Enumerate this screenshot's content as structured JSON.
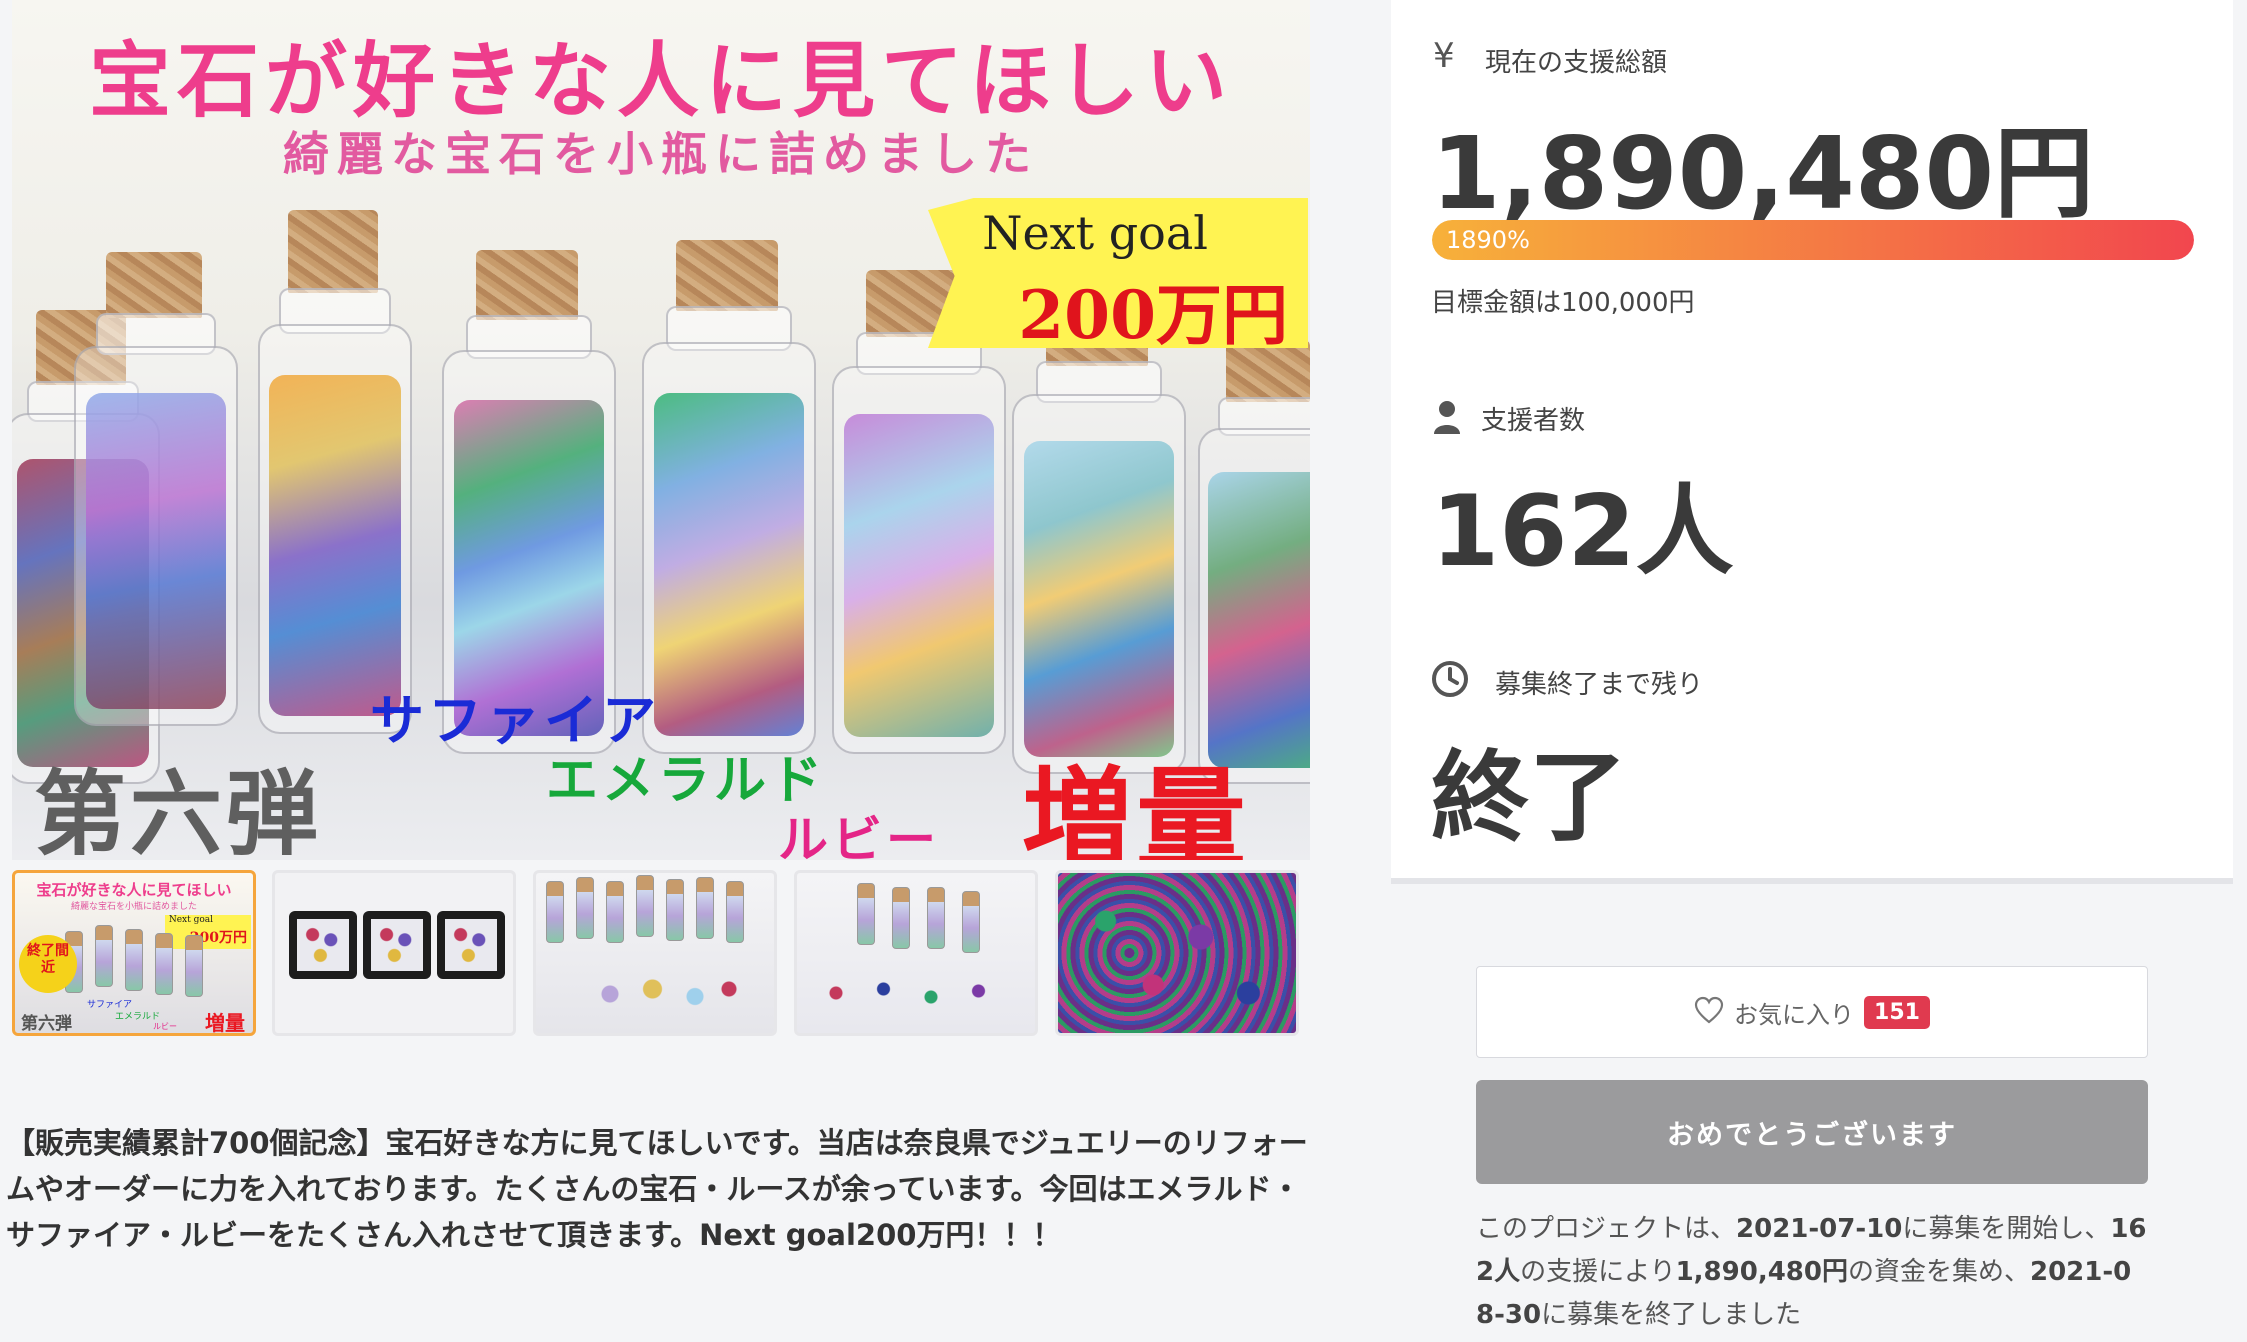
{
  "hero": {
    "title": "宝石が好きな人に見てほしい",
    "subtitle": "綺麗な宝石を小瓶に詰めました",
    "goal_line1": "Next goal",
    "goal_line2": "200万円",
    "series": "第六弾",
    "gem_sapphire": "サファイア",
    "gem_emerald": "エメラルド",
    "gem_ruby": "ルビー",
    "increase": "増量"
  },
  "thumbnails": {
    "t1": {
      "title": "宝石が好きな人に見てほしい",
      "subtitle": "綺麗な宝石を小瓶に詰めました",
      "goal_line1": "Next goal",
      "goal_line2": "200万円",
      "badge": "終了間近",
      "series": "第六弾",
      "gem_sapphire": "サファイア",
      "gem_emerald": "エメラルド",
      "gem_ruby": "ルビー",
      "increase": "増量"
    }
  },
  "description": "【販売実績累計700個記念】宝石好きな方に見てほしいです。当店は奈良県でジュエリーのリフォームやオーダーに力を入れております。たくさんの宝石・ルースが余っています。今回はエメラルド・サファイア・ルビーをたくさん入れさせて頂きます。Next goal200万円！！！",
  "stats": {
    "amount_label": "現在の支援総額",
    "amount_icon": "¥",
    "amount": "1,890,480円",
    "progress_text": "1890%",
    "progress_fraction": 1.0,
    "goal_text": "目標金額は100,000円",
    "backers_label": "支援者数",
    "backers": "162人",
    "remaining_label": "募集終了まで残り",
    "remaining": "終了"
  },
  "favorite": {
    "label": "お気に入り",
    "count": "151"
  },
  "cta": {
    "label": "おめでとうございます"
  },
  "summary": {
    "p1": "このプロジェクトは、",
    "start_date": "2021-07-10",
    "p2": "に募集を開始し、",
    "backers": "162人",
    "p3": "の支援により",
    "amount": "1,890,480円",
    "p4": "の資金を集め、",
    "end_date": "2021-08-30",
    "p5": "に募集を終了しました"
  },
  "colors": {
    "progress_start": "#f7b13a",
    "progress_end": "#f2464e",
    "title_pink": "#ee3d8c",
    "goal_red": "#e0141c",
    "badge_yellow": "#fff352",
    "fav_badge": "#e03a4f",
    "cta_gray": "#9b9b9d"
  }
}
